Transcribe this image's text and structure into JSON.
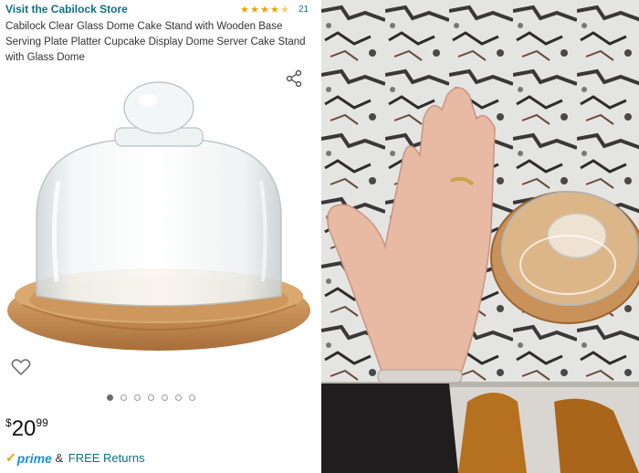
{
  "product": {
    "store_link": "Visit the Cabilock Store",
    "rating_count": "21",
    "rating_stars": 4.5,
    "title": "Cabilock Clear Glass Dome Cake Stand with Wooden Base Serving Plate Platter Cupcake Display Dome Server Cake Stand with Glass Dome",
    "price": {
      "symbol": "$",
      "whole": "20",
      "cents": "99"
    },
    "shipping": {
      "prime_label": "prime",
      "joiner": " & ",
      "returns_label": "FREE Returns"
    },
    "carousel": {
      "count": 7,
      "active_index": 0
    }
  },
  "icons": {
    "share": "share-icon",
    "favorite": "heart-icon",
    "star": "star-icon"
  },
  "colors": {
    "link": "#0f6f84",
    "star": "#f0a100",
    "prime_blue": "#1e90d6",
    "prime_check": "#f29a00"
  }
}
